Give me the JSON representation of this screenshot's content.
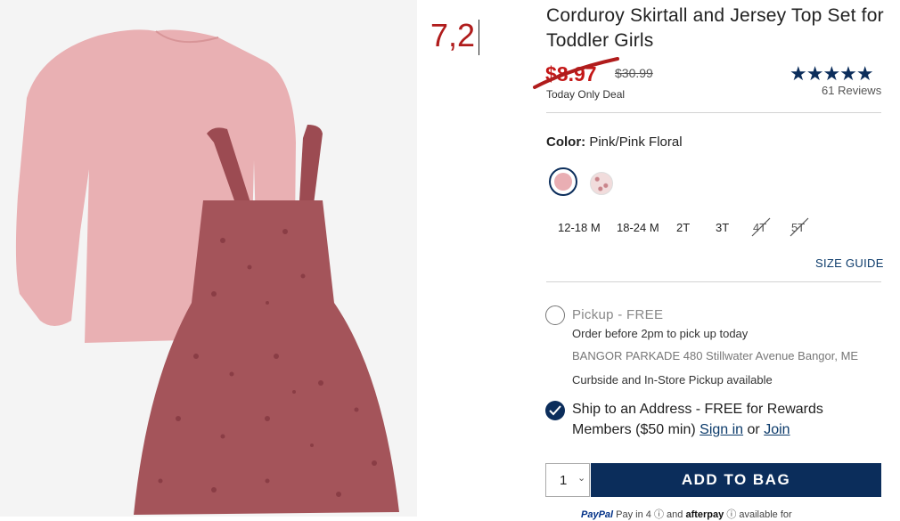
{
  "annotation": {
    "text": "7,2"
  },
  "product": {
    "title": "Corduroy Skirtall and Jersey Top Set for Toddler Girls",
    "sale_price": "$8.97",
    "original_price": "$30.99",
    "deal_label": "Today Only Deal",
    "rating_stars": "★★★★★",
    "rating_value": 5,
    "reviews": "61 Reviews"
  },
  "color": {
    "label": "Color:",
    "value": "Pink/Pink Floral",
    "swatches": [
      "pink",
      "pink-floral"
    ],
    "selected_swatch": "pink"
  },
  "sizes": [
    {
      "label": "12-18 M",
      "available": true
    },
    {
      "label": "18-24 M",
      "available": true
    },
    {
      "label": "2T",
      "available": true
    },
    {
      "label": "3T",
      "available": true
    },
    {
      "label": "4T",
      "available": false
    },
    {
      "label": "5T",
      "available": false
    }
  ],
  "size_guide": "SIZE GUIDE",
  "pickup": {
    "label": "Pickup - FREE",
    "sub": "Order before 2pm to pick up today",
    "store_name": "BANGOR PARKADE",
    "store_address": "480 Stillwater Avenue",
    "store_city": "Bangor, ME",
    "curbside": "Curbside and In-Store Pickup available"
  },
  "ship": {
    "line1": "Ship to an Address - FREE for Rewards",
    "line2_prefix": "Members ($50 min)",
    "sign_in": "Sign in",
    "or": "or",
    "join": "Join"
  },
  "cart": {
    "quantity": "1",
    "add_button": "ADD TO BAG"
  },
  "paypal": {
    "brand": "PayPal",
    "text": "Pay in 4",
    "and": "and",
    "afterpay": "afterpay",
    "suffix": "available for"
  },
  "colors": {
    "brand_navy": "#0b2d5b",
    "sale_red": "#c41818",
    "shirt_pink": "#e9aeb3",
    "dress_rose": "#a4545a"
  }
}
